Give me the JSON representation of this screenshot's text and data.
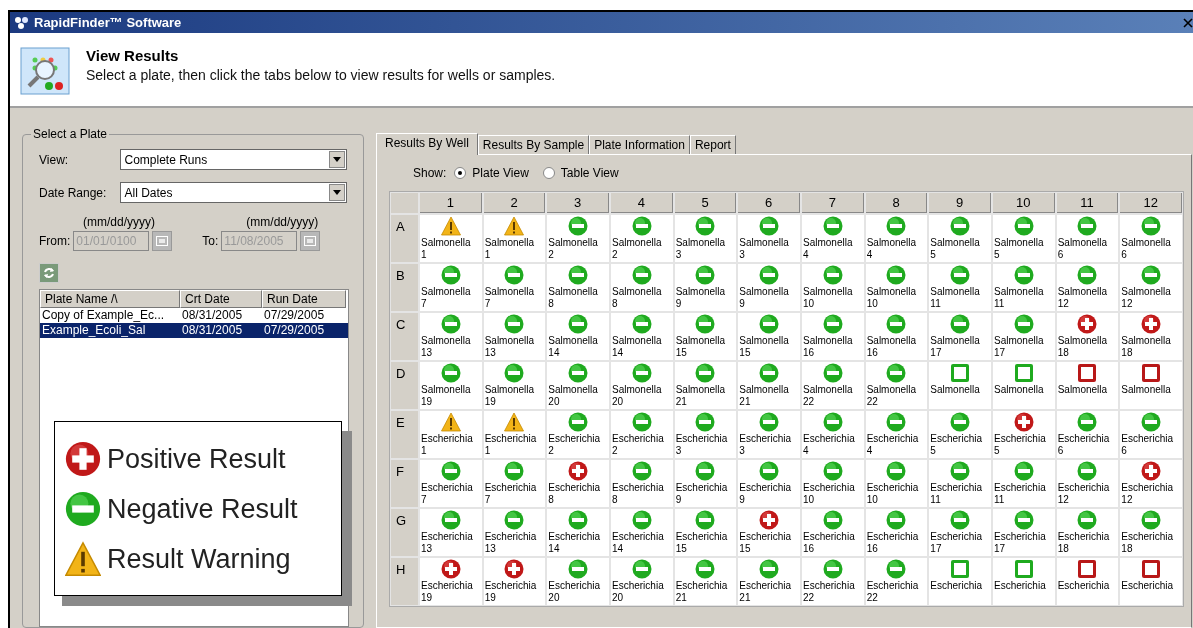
{
  "window": {
    "title": "RapidFinder™ Software"
  },
  "header": {
    "title": "View Results",
    "subtitle": "Select a plate, then click the tabs below to view results for wells or samples."
  },
  "select_plate": {
    "title": "Select a Plate",
    "view": {
      "label": "View:",
      "value": "Complete Runs"
    },
    "date_range": {
      "label": "Date Range:",
      "value": "All Dates"
    },
    "from": {
      "format": "(mm/dd/yyyy)",
      "label": "From:",
      "value": "01/01/0100",
      "disabled": true
    },
    "to": {
      "format": "(mm/dd/yyyy)",
      "label": "To:",
      "value": "11/08/2005",
      "disabled": true
    },
    "table": {
      "columns": [
        "Plate Name /\\",
        "Crt Date",
        "Run Date"
      ],
      "rows": [
        {
          "cells": [
            "Copy of Example_Ec...",
            "08/31/2005",
            "07/29/2005"
          ],
          "selected": false
        },
        {
          "cells": [
            "Example_Ecoli_Sal",
            "08/31/2005",
            "07/29/2005"
          ],
          "selected": true
        }
      ]
    }
  },
  "legend": [
    {
      "kind": "positive",
      "label": "Positive Result"
    },
    {
      "kind": "negative",
      "label": "Negative Result"
    },
    {
      "kind": "warning",
      "label": "Result Warning"
    }
  ],
  "tabs": [
    {
      "label": "Results By Well",
      "selected": true
    },
    {
      "label": "Results By Sample",
      "selected": false
    },
    {
      "label": "Plate Information",
      "selected": false
    },
    {
      "label": "Report",
      "selected": false
    }
  ],
  "show": {
    "label": "Show:",
    "options": [
      {
        "label": "Plate View",
        "selected": true
      },
      {
        "label": "Table View",
        "selected": false
      }
    ]
  },
  "plate": {
    "columns": [
      "1",
      "2",
      "3",
      "4",
      "5",
      "6",
      "7",
      "8",
      "9",
      "10",
      "11",
      "12"
    ],
    "rows": [
      {
        "label": "A",
        "wells": [
          {
            "kind": "warning",
            "name": "Salmonella",
            "sample": "1"
          },
          {
            "kind": "warning",
            "name": "Salmonella",
            "sample": "1"
          },
          {
            "kind": "negative",
            "name": "Salmonella",
            "sample": "2"
          },
          {
            "kind": "negative",
            "name": "Salmonella",
            "sample": "2"
          },
          {
            "kind": "negative",
            "name": "Salmonella",
            "sample": "3"
          },
          {
            "kind": "negative",
            "name": "Salmonella",
            "sample": "3"
          },
          {
            "kind": "negative",
            "name": "Salmonella",
            "sample": "4"
          },
          {
            "kind": "negative",
            "name": "Salmonella",
            "sample": "4"
          },
          {
            "kind": "negative",
            "name": "Salmonella",
            "sample": "5"
          },
          {
            "kind": "negative",
            "name": "Salmonella",
            "sample": "5"
          },
          {
            "kind": "negative",
            "name": "Salmonella",
            "sample": "6"
          },
          {
            "kind": "negative",
            "name": "Salmonella",
            "sample": "6"
          }
        ]
      },
      {
        "label": "B",
        "wells": [
          {
            "kind": "negative",
            "name": "Salmonella",
            "sample": "7"
          },
          {
            "kind": "negative",
            "name": "Salmonella",
            "sample": "7"
          },
          {
            "kind": "negative",
            "name": "Salmonella",
            "sample": "8"
          },
          {
            "kind": "negative",
            "name": "Salmonella",
            "sample": "8"
          },
          {
            "kind": "negative",
            "name": "Salmonella",
            "sample": "9"
          },
          {
            "kind": "negative",
            "name": "Salmonella",
            "sample": "9"
          },
          {
            "kind": "negative",
            "name": "Salmonella",
            "sample": "10"
          },
          {
            "kind": "negative",
            "name": "Salmonella",
            "sample": "10"
          },
          {
            "kind": "negative",
            "name": "Salmonella",
            "sample": "11"
          },
          {
            "kind": "negative",
            "name": "Salmonella",
            "sample": "11"
          },
          {
            "kind": "negative",
            "name": "Salmonella",
            "sample": "12"
          },
          {
            "kind": "negative",
            "name": "Salmonella",
            "sample": "12"
          }
        ]
      },
      {
        "label": "C",
        "wells": [
          {
            "kind": "negative",
            "name": "Salmonella",
            "sample": "13"
          },
          {
            "kind": "negative",
            "name": "Salmonella",
            "sample": "13"
          },
          {
            "kind": "negative",
            "name": "Salmonella",
            "sample": "14"
          },
          {
            "kind": "negative",
            "name": "Salmonella",
            "sample": "14"
          },
          {
            "kind": "negative",
            "name": "Salmonella",
            "sample": "15"
          },
          {
            "kind": "negative",
            "name": "Salmonella",
            "sample": "15"
          },
          {
            "kind": "negative",
            "name": "Salmonella",
            "sample": "16"
          },
          {
            "kind": "negative",
            "name": "Salmonella",
            "sample": "16"
          },
          {
            "kind": "negative",
            "name": "Salmonella",
            "sample": "17"
          },
          {
            "kind": "negative",
            "name": "Salmonella",
            "sample": "17"
          },
          {
            "kind": "positive",
            "name": "Salmonella",
            "sample": "18"
          },
          {
            "kind": "positive",
            "name": "Salmonella",
            "sample": "18"
          }
        ]
      },
      {
        "label": "D",
        "wells": [
          {
            "kind": "negative",
            "name": "Salmonella",
            "sample": "19"
          },
          {
            "kind": "negative",
            "name": "Salmonella",
            "sample": "19"
          },
          {
            "kind": "negative",
            "name": "Salmonella",
            "sample": "20"
          },
          {
            "kind": "negative",
            "name": "Salmonella",
            "sample": "20"
          },
          {
            "kind": "negative",
            "name": "Salmonella",
            "sample": "21"
          },
          {
            "kind": "negative",
            "name": "Salmonella",
            "sample": "21"
          },
          {
            "kind": "negative",
            "name": "Salmonella",
            "sample": "22"
          },
          {
            "kind": "negative",
            "name": "Salmonella",
            "sample": "22"
          },
          {
            "kind": "negative_control",
            "name": "Salmonella"
          },
          {
            "kind": "negative_control",
            "name": "Salmonella"
          },
          {
            "kind": "positive_control",
            "name": "Salmonella"
          },
          {
            "kind": "positive_control",
            "name": "Salmonella"
          }
        ]
      },
      {
        "label": "E",
        "wells": [
          {
            "kind": "warning",
            "name": "Escherichia",
            "sample": "1"
          },
          {
            "kind": "warning",
            "name": "Escherichia",
            "sample": "1"
          },
          {
            "kind": "negative",
            "name": "Escherichia",
            "sample": "2"
          },
          {
            "kind": "negative",
            "name": "Escherichia",
            "sample": "2"
          },
          {
            "kind": "negative",
            "name": "Escherichia",
            "sample": "3"
          },
          {
            "kind": "negative",
            "name": "Escherichia",
            "sample": "3"
          },
          {
            "kind": "negative",
            "name": "Escherichia",
            "sample": "4"
          },
          {
            "kind": "negative",
            "name": "Escherichia",
            "sample": "4"
          },
          {
            "kind": "negative",
            "name": "Escherichia",
            "sample": "5"
          },
          {
            "kind": "positive",
            "name": "Escherichia",
            "sample": "5"
          },
          {
            "kind": "negative",
            "name": "Escherichia",
            "sample": "6"
          },
          {
            "kind": "negative",
            "name": "Escherichia",
            "sample": "6"
          }
        ]
      },
      {
        "label": "F",
        "wells": [
          {
            "kind": "negative",
            "name": "Escherichia",
            "sample": "7"
          },
          {
            "kind": "negative",
            "name": "Escherichia",
            "sample": "7"
          },
          {
            "kind": "positive",
            "name": "Escherichia",
            "sample": "8"
          },
          {
            "kind": "negative",
            "name": "Escherichia",
            "sample": "8"
          },
          {
            "kind": "negative",
            "name": "Escherichia",
            "sample": "9"
          },
          {
            "kind": "negative",
            "name": "Escherichia",
            "sample": "9"
          },
          {
            "kind": "negative",
            "name": "Escherichia",
            "sample": "10"
          },
          {
            "kind": "negative",
            "name": "Escherichia",
            "sample": "10"
          },
          {
            "kind": "negative",
            "name": "Escherichia",
            "sample": "11"
          },
          {
            "kind": "negative",
            "name": "Escherichia",
            "sample": "11"
          },
          {
            "kind": "negative",
            "name": "Escherichia",
            "sample": "12"
          },
          {
            "kind": "positive",
            "name": "Escherichia",
            "sample": "12"
          }
        ]
      },
      {
        "label": "G",
        "wells": [
          {
            "kind": "negative",
            "name": "Escherichia",
            "sample": "13"
          },
          {
            "kind": "negative",
            "name": "Escherichia",
            "sample": "13"
          },
          {
            "kind": "negative",
            "name": "Escherichia",
            "sample": "14"
          },
          {
            "kind": "negative",
            "name": "Escherichia",
            "sample": "14"
          },
          {
            "kind": "negative",
            "name": "Escherichia",
            "sample": "15"
          },
          {
            "kind": "positive",
            "name": "Escherichia",
            "sample": "15"
          },
          {
            "kind": "negative",
            "name": "Escherichia",
            "sample": "16"
          },
          {
            "kind": "negative",
            "name": "Escherichia",
            "sample": "16"
          },
          {
            "kind": "negative",
            "name": "Escherichia",
            "sample": "17"
          },
          {
            "kind": "negative",
            "name": "Escherichia",
            "sample": "17"
          },
          {
            "kind": "negative",
            "name": "Escherichia",
            "sample": "18"
          },
          {
            "kind": "negative",
            "name": "Escherichia",
            "sample": "18"
          }
        ]
      },
      {
        "label": "H",
        "wells": [
          {
            "kind": "positive",
            "name": "Escherichia",
            "sample": "19"
          },
          {
            "kind": "positive",
            "name": "Escherichia",
            "sample": "19"
          },
          {
            "kind": "negative",
            "name": "Escherichia",
            "sample": "20"
          },
          {
            "kind": "negative",
            "name": "Escherichia",
            "sample": "20"
          },
          {
            "kind": "negative",
            "name": "Escherichia",
            "sample": "21"
          },
          {
            "kind": "negative",
            "name": "Escherichia",
            "sample": "21"
          },
          {
            "kind": "negative",
            "name": "Escherichia",
            "sample": "22"
          },
          {
            "kind": "negative",
            "name": "Escherichia",
            "sample": "22"
          },
          {
            "kind": "negative_control",
            "name": "Escherichia"
          },
          {
            "kind": "negative_control",
            "name": "Escherichia"
          },
          {
            "kind": "positive_control",
            "name": "Escherichia"
          },
          {
            "kind": "positive_control",
            "name": "Escherichia"
          }
        ]
      }
    ]
  }
}
